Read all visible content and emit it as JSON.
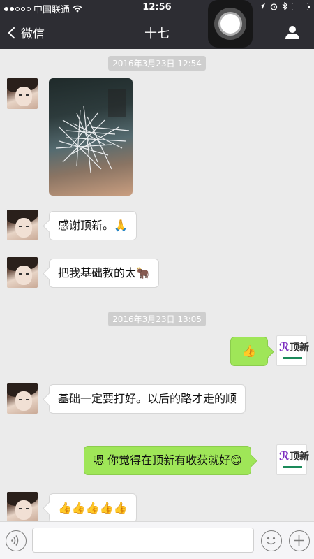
{
  "status_bar": {
    "carrier": "中国联通",
    "time": "12:56"
  },
  "nav": {
    "back_label": "微信",
    "title": "十七"
  },
  "messages": [
    {
      "type": "timestamp",
      "text": "2016年3月23日 12:54"
    },
    {
      "type": "image",
      "side": "left",
      "description": "photo"
    },
    {
      "type": "text",
      "side": "left",
      "text": "感谢顶新。🙏"
    },
    {
      "type": "text",
      "side": "left",
      "text": "把我基础教的太🐂"
    },
    {
      "type": "timestamp",
      "text": "2016年3月23日 13:05"
    },
    {
      "type": "text",
      "side": "right",
      "text": "👍"
    },
    {
      "type": "text",
      "side": "left",
      "text": "基础一定要打好。以后的路才走的顺"
    },
    {
      "type": "text",
      "side": "right",
      "text": "嗯 你觉得在顶新有收获就好😊"
    },
    {
      "type": "text",
      "side": "left",
      "text": "👍👍👍👍👍"
    }
  ],
  "right_avatar_logo": "顶新",
  "input": {
    "value": ""
  },
  "colors": {
    "nav_bg": "#2d2d33",
    "chat_bg": "#ebebeb",
    "bubble_right": "#9fe658",
    "bubble_left": "#ffffff"
  }
}
